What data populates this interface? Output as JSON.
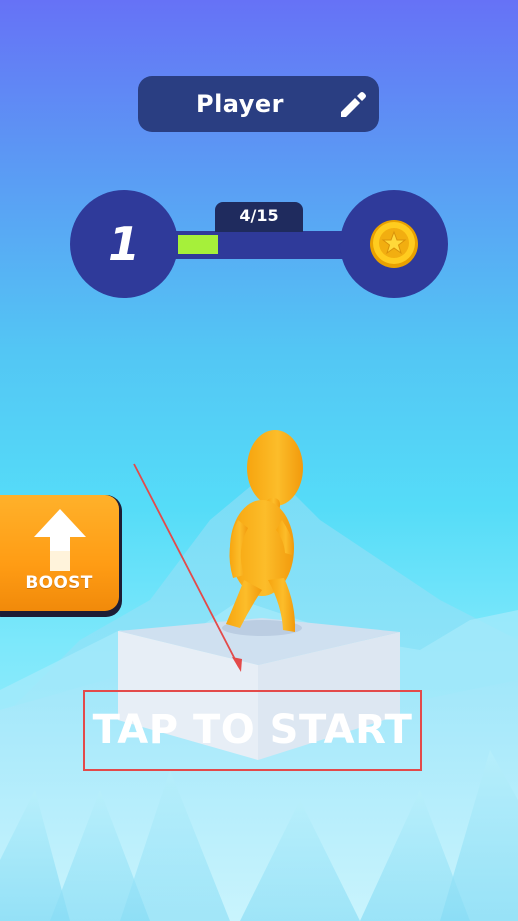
{
  "header": {
    "player_name": "Player",
    "edit_icon": "pencil-icon"
  },
  "level": {
    "current": "1",
    "progress_text": "4/15",
    "progress_fraction": 0.267,
    "reward_icon": "star-coin-icon"
  },
  "boost": {
    "label": "BOOST",
    "icon": "up-arrow-icon"
  },
  "start": {
    "label": "TAP TO START"
  },
  "colors": {
    "panel": "#2a3e82",
    "level_track": "#2f3a9a",
    "progress_fill": "#a6f03a",
    "boost": "#ff9c14",
    "annotation": "#e34a4a",
    "character": "#fbb21b"
  }
}
